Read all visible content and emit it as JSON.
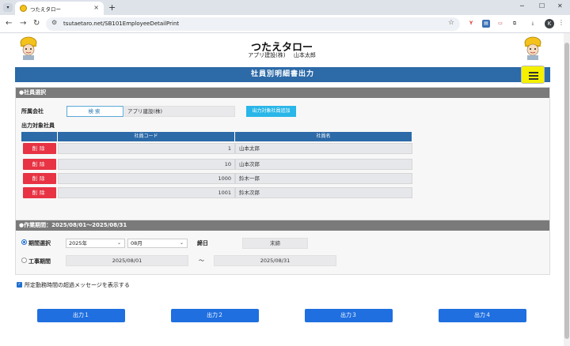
{
  "browser": {
    "tab_title": "つたえタロー",
    "url": "tsutaetaro.net/SB101EmployeeDetailPrint",
    "avatar_letter": "K"
  },
  "app": {
    "title": "つたえタロー",
    "company": "アプリ建設(株)",
    "user": "山本太郎",
    "page_heading": "社員別明細書出力"
  },
  "employee_section": {
    "heading": "●社員選択",
    "company_label": "所属会社",
    "search_button": "検索",
    "company_value": "アプリ建設(株)",
    "bulk_add_button": "出力対象社員追加",
    "target_label": "出力対象社員",
    "columns": [
      "社員コード",
      "社員名"
    ],
    "delete_label": "削除",
    "rows": [
      {
        "code": "1",
        "name": "山本太郎"
      },
      {
        "code": "10",
        "name": "山本次郎"
      },
      {
        "code": "1000",
        "name": "鈴木一郎"
      },
      {
        "code": "1001",
        "name": "鈴木次郎"
      }
    ]
  },
  "period_section": {
    "heading": "●作業期間：2025/08/01～2025/08/31",
    "period_select_label": "期間選択",
    "year_value": "2025年",
    "month_value": "08月",
    "closing_label": "締日",
    "closing_value": "末締",
    "work_period_label": "工事期間",
    "start_date": "2025/08/01",
    "tilde": "～",
    "end_date": "2025/08/31"
  },
  "overtime_checkbox_label": "所定勤務時間の超過メッセージを表示する",
  "output_buttons": [
    "出力１",
    "出力２",
    "出力３",
    "出力４"
  ],
  "colors": {
    "header_blue": "#2c6aa8",
    "delete_red": "#e73343",
    "menu_yellow": "#f4f000",
    "output_blue": "#1f6fe0"
  }
}
